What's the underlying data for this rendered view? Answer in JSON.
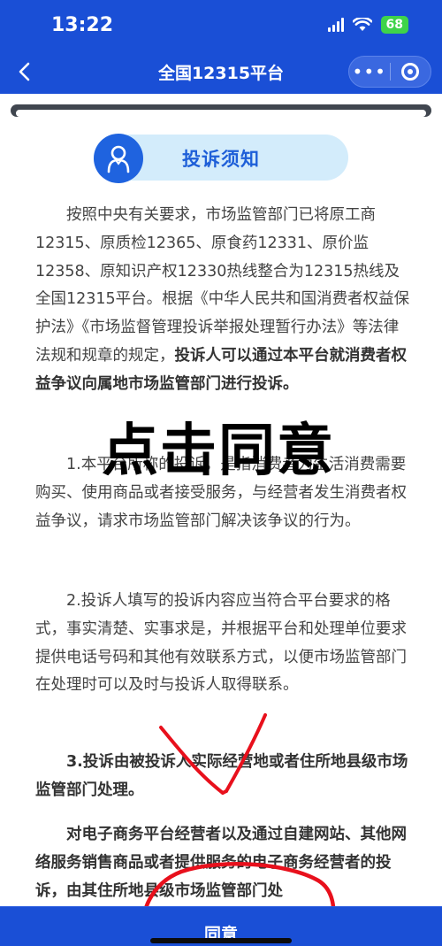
{
  "status_bar": {
    "time": "13:22",
    "battery": "68"
  },
  "navbar": {
    "title": "全国12315平台"
  },
  "notice": {
    "title": "投诉须知",
    "p1_normal": "按照中央有关要求，市场监管部门已将原工商12315、原质检12365、原食药12331、原价监12358、原知识产权12330热线整合为12315热线及全国12315平台。根据《中华人民共和国消费者权益保护法》《市场监督管理投诉举报处理暂行办法》等法律法规和规章的规定，",
    "p1_bold": "投诉人可以通过本平台就消费者权益争议向属地市场监管部门进行投诉。",
    "p2": "1.本平台所称的投诉，是指消费者为生活消费需要购买、使用商品或者接受服务，与经营者发生消费者权益争议，请求市场监管部门解决该争议的行为。",
    "p3": "2.投诉人填写的投诉内容应当符合平台要求的格式，事实清楚、实事求是，并根据平台和处理单位要求提供电话号码和其他有效联系方式，以便市场监管部门在处理时可以及时与投诉人取得联系。",
    "p4": "3.投诉由被投诉人实际经营地或者住所地县级市场监管部门处理。",
    "p5": "对电子商务平台经营者以及通过自建网站、其他网络服务销售商品或者提供服务的电子商务经营者的投诉，由其住所地县级市场监管部门处"
  },
  "annotation": {
    "text": "点击同意",
    "color": "#e8101c"
  },
  "footer": {
    "agree_label": "同意"
  },
  "colors": {
    "brand": "#1a4fd6",
    "accent_text": "#1e5fd8",
    "pill_bg": "#d3ecfb"
  }
}
